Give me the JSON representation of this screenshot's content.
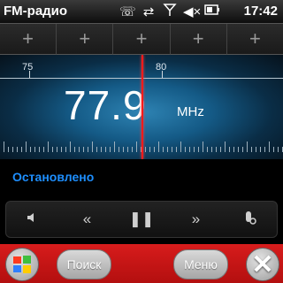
{
  "titlebar": {
    "app_title": "FM-радио",
    "clock": "17:42",
    "icons": [
      "phone-icon",
      "sync-icon",
      "signal-icon",
      "volume-icon",
      "battery-icon"
    ]
  },
  "presets": [
    "+",
    "+",
    "+",
    "+",
    "+"
  ],
  "dial": {
    "scale_labels": [
      "75",
      "80"
    ],
    "frequency": "77.9",
    "unit": "MHz"
  },
  "status": "Остановлено",
  "controls": {
    "speaker": "speaker-icon",
    "prev": "«",
    "pause": "❚❚",
    "next": "»",
    "headset": "headset-icon"
  },
  "bottombar": {
    "search_label": "Поиск",
    "menu_label": "Меню",
    "close_label": "✕"
  },
  "colors": {
    "accent_red": "#c41414",
    "status_blue": "#1e8fff",
    "needle": "#ff1a1a"
  }
}
